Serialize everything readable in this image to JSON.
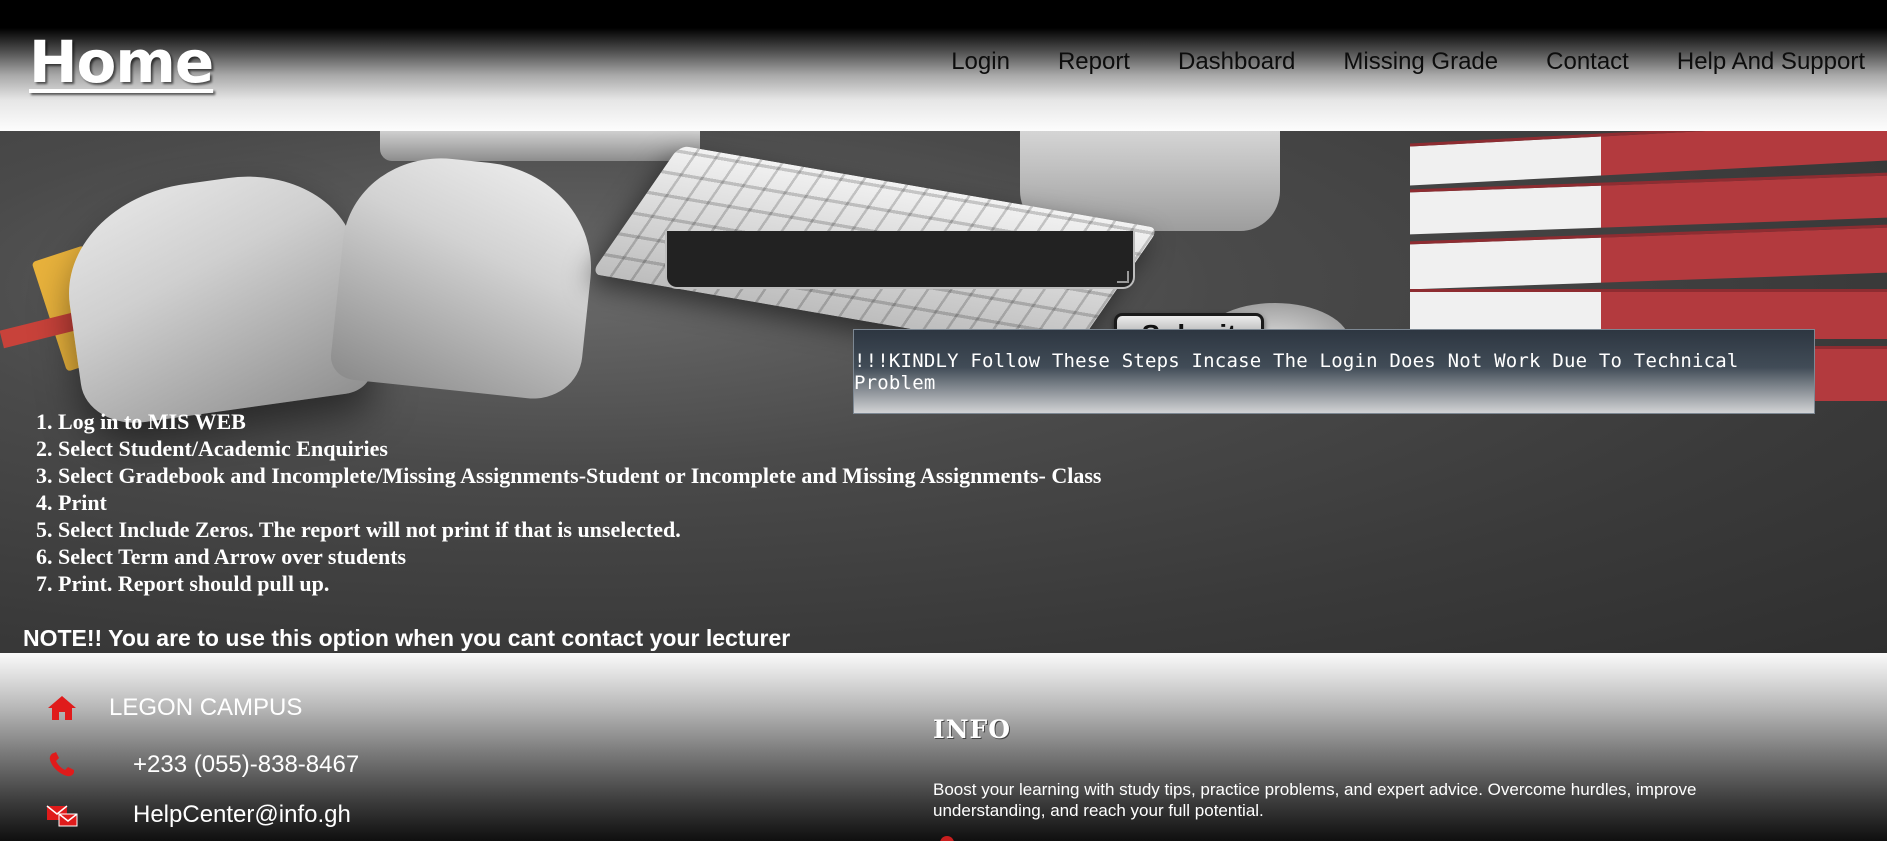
{
  "header": {
    "brand": "Home",
    "nav": [
      {
        "label": "Login"
      },
      {
        "label": "Report"
      },
      {
        "label": "Dashboard"
      },
      {
        "label": "Missing Grade"
      },
      {
        "label": "Contact"
      },
      {
        "label": "Help And Support"
      }
    ]
  },
  "form": {
    "submit_label": "Submit"
  },
  "notice": {
    "text": "!!!KINDLY Follow These Steps Incase The Login Does Not Work Due To Technical Problem"
  },
  "steps": [
    "1. Log in to MIS WEB",
    "2. Select Student/Academic Enquiries",
    "3. Select Gradebook and Incomplete/Missing Assignments-Student or Incomplete and Missing Assignments- Class",
    "4. Print",
    "5. Select Include Zeros. The report will not print if that is unselected.",
    "6. Select Term and Arrow over students",
    "7. Print. Report should pull up."
  ],
  "note": "NOTE!! You are to use this option when you cant contact your lecturer",
  "footer": {
    "campus": "LEGON CAMPUS",
    "phone": "+233 (055)-838-8467",
    "email": "HelpCenter@info.gh",
    "info_title": "INFO",
    "info_text": "Boost your learning with study tips, practice problems, and expert advice. Overcome hurdles, improve understanding, and reach your full potential.",
    "icons": [
      "home-icon",
      "phone-icon",
      "mail-icon"
    ],
    "icon_color": "#e01b1b"
  }
}
